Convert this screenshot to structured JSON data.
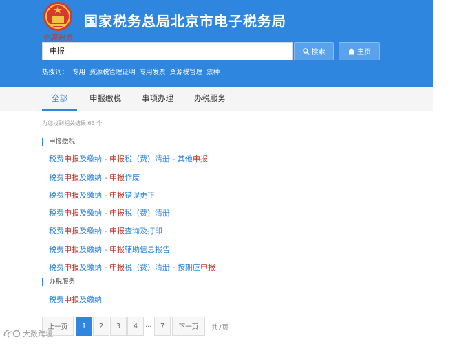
{
  "header": {
    "brand_script": "中国税务",
    "title": "国家税务总局北京市电子税务局",
    "search_value": "申报",
    "search_button": "搜索",
    "home_button": "主页",
    "hot_label": "热搜词：",
    "hot_words": [
      "专用",
      "资源税管理证明",
      "专用发票",
      "资源税管理",
      "票种"
    ]
  },
  "tabs": [
    "全部",
    "申报缴税",
    "事项办理",
    "办税服务"
  ],
  "active_tab": "全部",
  "result_count": "为您找到相关结果 63 个",
  "sections": [
    {
      "title": "申报缴税",
      "results": [
        [
          [
            "税费",
            false
          ],
          [
            "申报",
            true
          ],
          [
            "及缴纳 - ",
            false
          ],
          [
            "申报",
            true
          ],
          [
            "税（费）清册 - 其他",
            false
          ],
          [
            "申报",
            true
          ]
        ],
        [
          [
            "税费",
            false
          ],
          [
            "申报",
            true
          ],
          [
            "及缴纳 - ",
            false
          ],
          [
            "申报",
            true
          ],
          [
            "作废",
            false
          ]
        ],
        [
          [
            "税费",
            false
          ],
          [
            "申报",
            true
          ],
          [
            "及缴纳 - ",
            false
          ],
          [
            "申报",
            true
          ],
          [
            "错误更正",
            false
          ]
        ],
        [
          [
            "税费",
            false
          ],
          [
            "申报",
            true
          ],
          [
            "及缴纳 - ",
            false
          ],
          [
            "申报",
            true
          ],
          [
            "税（费）清册",
            false
          ]
        ],
        [
          [
            "税费",
            false
          ],
          [
            "申报",
            true
          ],
          [
            "及缴纳 - ",
            false
          ],
          [
            "申报",
            true
          ],
          [
            "查询及打印",
            false
          ]
        ],
        [
          [
            "税费",
            false
          ],
          [
            "申报",
            true
          ],
          [
            "及缴纳 - ",
            false
          ],
          [
            "申报",
            true
          ],
          [
            "辅助信息报告",
            false
          ]
        ],
        [
          [
            "税费",
            false
          ],
          [
            "申报",
            true
          ],
          [
            "及缴纳 - ",
            false
          ],
          [
            "申报",
            true
          ],
          [
            "税（费）清册 - 按期应",
            false
          ],
          [
            "申报",
            true
          ]
        ]
      ]
    },
    {
      "title": "办税服务",
      "results": [
        [
          [
            "税费",
            false
          ],
          [
            "申报",
            true
          ],
          [
            "及缴纳",
            false
          ]
        ]
      ]
    }
  ],
  "pagination": {
    "prev": "上一页",
    "pages": [
      "1",
      "2",
      "3",
      "4"
    ],
    "ellipsis": "...",
    "last_page": "7",
    "next": "下一页",
    "total": "共7页",
    "current": "1"
  },
  "watermark": "大数跨境",
  "colors": {
    "header_bg": "#2e86de",
    "highlight": "#c0392b",
    "link": "#2e86de"
  },
  "icons": {
    "search": "magnifier-icon",
    "home": "home-icon",
    "emblem": "national-emblem-icon"
  }
}
